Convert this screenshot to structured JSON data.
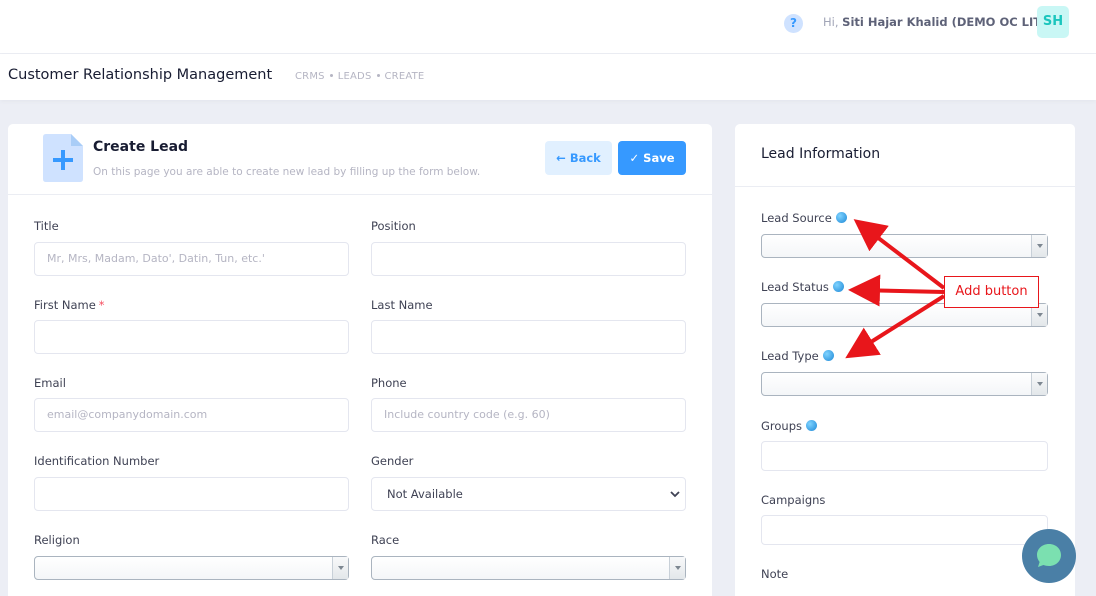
{
  "header": {
    "help_icon_glyph": "?",
    "greeting_prefix": "Hi,",
    "user_name": "Siti Hajar Khalid (DEMO OC LITE)",
    "avatar_initials": "SH"
  },
  "subheader": {
    "title": "Customer Relationship Management",
    "breadcrumb": [
      "CRMS",
      "LEADS",
      "CREATE"
    ]
  },
  "form": {
    "title": "Create Lead",
    "description": "On this page you are able to create new lead by filling up the form below.",
    "back_label": "Back",
    "save_label": "Save",
    "fields": {
      "title": {
        "label": "Title",
        "placeholder": "Mr, Mrs, Madam, Dato', Datin, Tun, etc.'"
      },
      "position": {
        "label": "Position",
        "placeholder": ""
      },
      "first_name": {
        "label": "First Name",
        "required_mark": "*",
        "placeholder": ""
      },
      "last_name": {
        "label": "Last Name",
        "placeholder": ""
      },
      "email": {
        "label": "Email",
        "placeholder": "email@companydomain.com"
      },
      "phone": {
        "label": "Phone",
        "placeholder": "Include country code (e.g. 60)"
      },
      "identification": {
        "label": "Identification Number",
        "placeholder": ""
      },
      "gender": {
        "label": "Gender",
        "value": "Not Available"
      },
      "religion": {
        "label": "Religion"
      },
      "race": {
        "label": "Race"
      }
    }
  },
  "lead_info": {
    "title": "Lead Information",
    "lead_source": "Lead Source",
    "lead_status": "Lead Status",
    "lead_type": "Lead Type",
    "groups": "Groups",
    "campaigns": "Campaigns",
    "note": "Note"
  },
  "annotation": {
    "label": "Add button",
    "color": "#e8161b"
  },
  "colors": {
    "primary": "#3699ff",
    "primary_light": "#e1f0ff",
    "required": "#f64e60",
    "chat": "#4a7fa6"
  }
}
